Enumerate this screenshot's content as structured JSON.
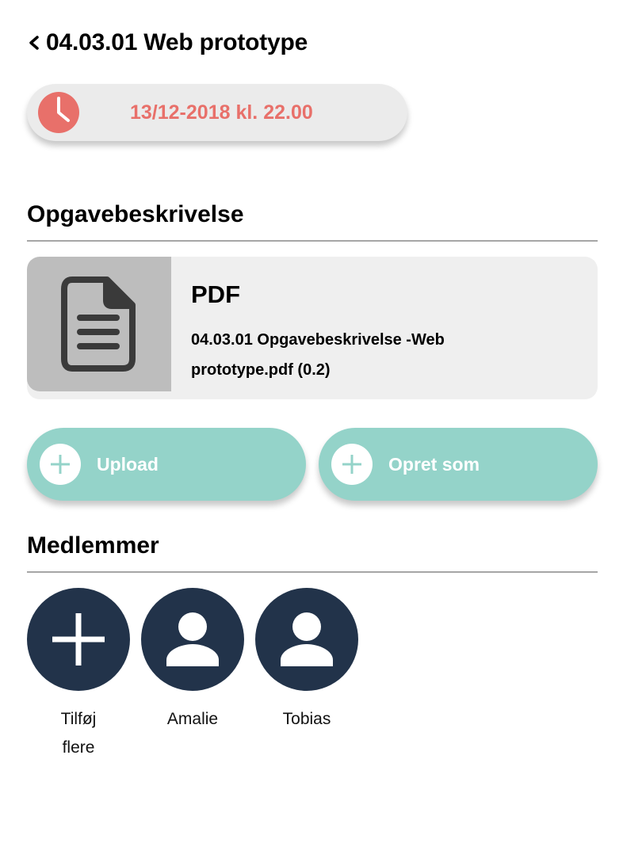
{
  "header": {
    "back_icon": "chevron-left-icon",
    "title": "04.03.01 Web prototype"
  },
  "deadline": {
    "icon": "clock-icon",
    "text": "13/12-2018 kl. 22.00",
    "color": "#e8706a"
  },
  "description": {
    "heading": "Opgavebeskrivelse",
    "file": {
      "icon": "document-icon",
      "type": "PDF",
      "name": "04.03.01 Opgavebeskrivelse -Web prototype.pdf (0.2)"
    }
  },
  "actions": {
    "upload_label": "Upload",
    "create_label": "Opret som",
    "icon": "plus-icon",
    "color": "#94d3c9"
  },
  "members": {
    "heading": "Medlemmer",
    "add_label": "Tilføj flere",
    "items": [
      {
        "name": "Amalie",
        "icon": "user-icon"
      },
      {
        "name": "Tobias",
        "icon": "user-icon"
      }
    ],
    "avatar_color": "#22334a"
  }
}
